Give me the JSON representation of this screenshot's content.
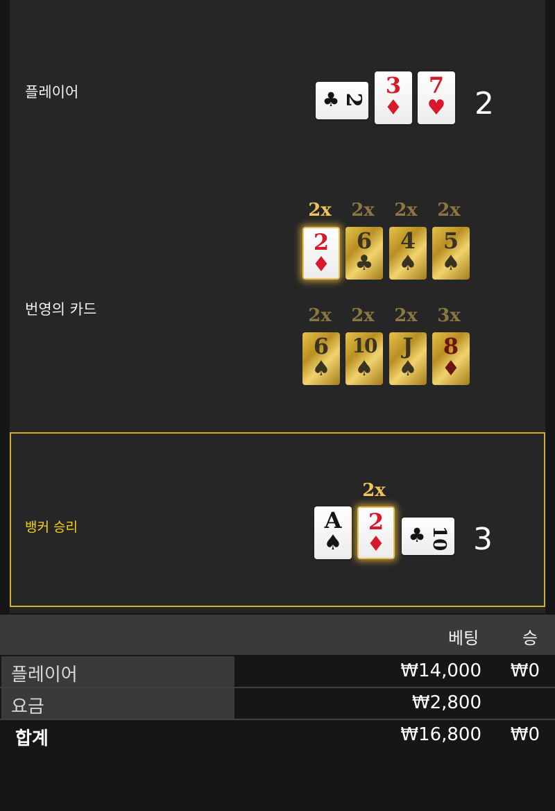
{
  "player": {
    "label": "플레이어",
    "score": "2",
    "cards": [
      {
        "rank": "2",
        "suit": "♣",
        "color": "black",
        "orientation": "sideways"
      },
      {
        "rank": "3",
        "suit": "♦",
        "color": "red",
        "orientation": "upright"
      },
      {
        "rank": "7",
        "suit": "♥",
        "color": "red",
        "orientation": "upright"
      }
    ]
  },
  "prosperity": {
    "label": "번영의 카드",
    "row1": [
      {
        "mult": "2x",
        "rank": "2",
        "suit": "♦",
        "active": true
      },
      {
        "mult": "2x",
        "rank": "6",
        "suit": "♣",
        "active": false
      },
      {
        "mult": "2x",
        "rank": "4",
        "suit": "♠",
        "active": false
      },
      {
        "mult": "2x",
        "rank": "5",
        "suit": "♠",
        "active": false
      }
    ],
    "row2": [
      {
        "mult": "2x",
        "rank": "6",
        "suit": "♠",
        "active": false
      },
      {
        "mult": "2x",
        "rank": "10",
        "suit": "♠",
        "active": false
      },
      {
        "mult": "2x",
        "rank": "J",
        "suit": "♠",
        "active": false
      },
      {
        "mult": "3x",
        "rank": "8",
        "suit": "♦",
        "active": false
      }
    ]
  },
  "banker": {
    "label": "뱅커 승리",
    "score": "3",
    "mult": "2x",
    "cards": [
      {
        "rank": "A",
        "suit": "♠",
        "color": "black",
        "orientation": "upright"
      },
      {
        "rank": "2",
        "suit": "♦",
        "color": "red",
        "orientation": "upright",
        "highlighted": true
      },
      {
        "rank": "10",
        "suit": "♣",
        "color": "black",
        "orientation": "sideways"
      }
    ]
  },
  "table": {
    "headers": {
      "bet": "베팅",
      "win": "승"
    },
    "rows": [
      {
        "label": "플레이어",
        "bet": "₩14,000",
        "win": "₩0"
      },
      {
        "label": "요금",
        "bet": "₩2,800",
        "win": ""
      }
    ],
    "total": {
      "label": "합계",
      "bet": "₩16,800",
      "win": "₩0"
    }
  },
  "colors": {
    "accent": "#cfb323",
    "banker_label": "#f5d31a",
    "red_suit": "#d7192b",
    "gold_card": "#d4ad3c"
  }
}
